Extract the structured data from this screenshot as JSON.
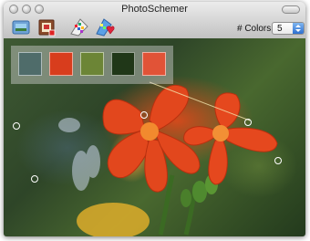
{
  "window": {
    "title": "PhotoSchemer"
  },
  "toolbar": {
    "tools": [
      {
        "icon": "folder-photo-icon"
      },
      {
        "icon": "image-frame-icon"
      },
      {
        "icon": "palette-grid-icon"
      },
      {
        "icon": "heart-palette-icon"
      }
    ],
    "colors_label": "# Colors:",
    "colors_value": "5"
  },
  "palette": {
    "swatches": [
      "#4f6c6a",
      "#d83d1d",
      "#6c8536",
      "#203718",
      "#e15337"
    ]
  }
}
